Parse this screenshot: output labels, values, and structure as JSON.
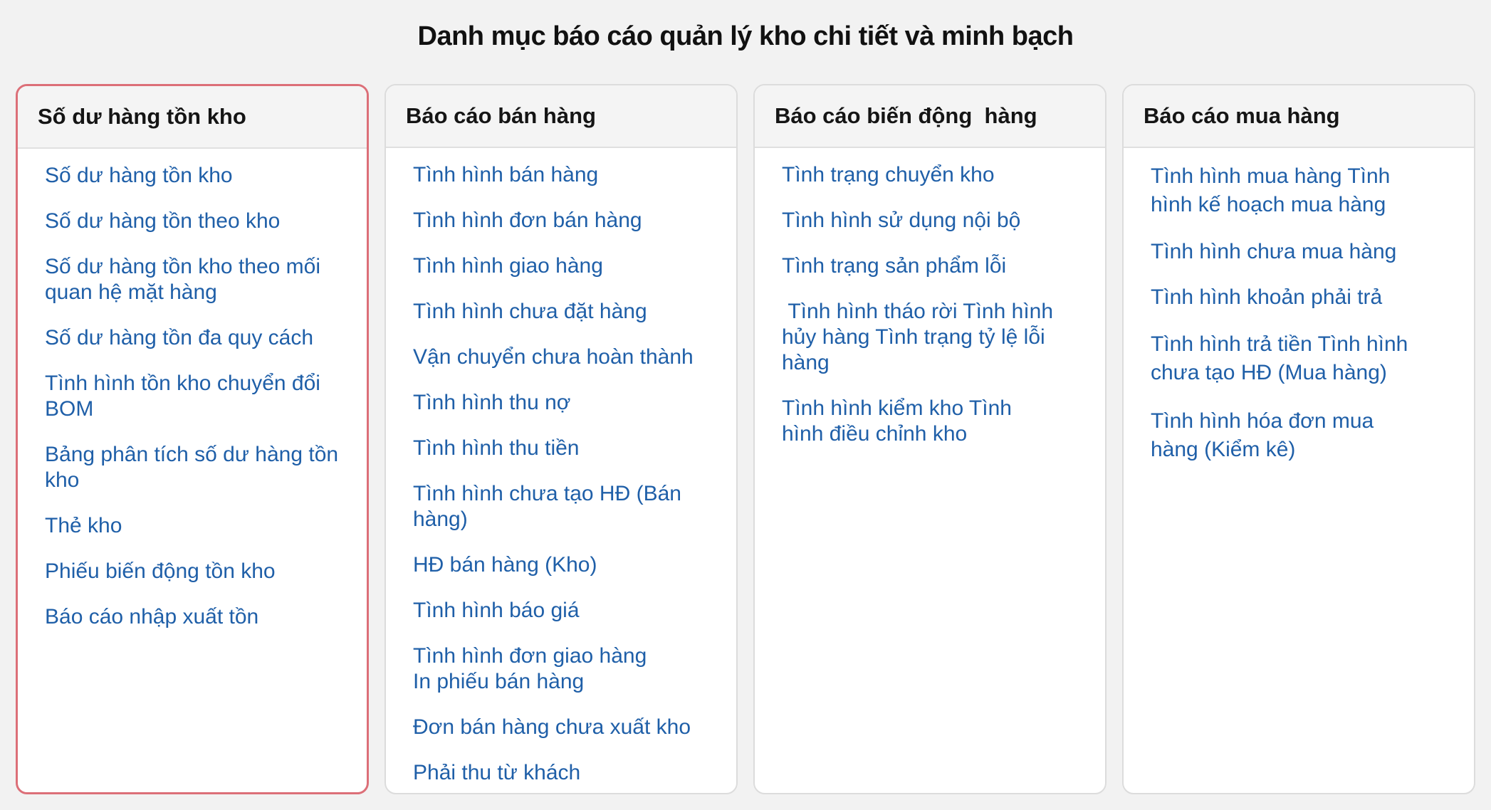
{
  "page": {
    "title": "Danh mục báo cáo quản lý kho chi tiết và minh bạch"
  },
  "colors": {
    "background": "#f2f2f2",
    "link": "#1f5fa8",
    "selected_border": "#dc6f78",
    "header_bg": "#f4f4f4"
  },
  "panels": [
    {
      "title": "Số dư hàng tồn kho",
      "selected": true,
      "items": [
        "Số dư hàng tồn kho",
        "Số dư hàng tồn theo kho",
        "Số dư hàng tồn kho theo mối quan hệ mặt hàng",
        "Số dư hàng tồn đa quy cách",
        "Tình hình tồn kho chuyển đổi BOM",
        "Bảng phân tích số dư hàng tồn kho",
        "Thẻ kho",
        "Phiếu biến động tồn kho",
        "Báo cáo nhập xuất tồn"
      ]
    },
    {
      "title": "Báo cáo bán hàng",
      "selected": false,
      "items": [
        "Tình hình bán hàng",
        "Tình hình đơn bán hàng",
        "Tình hình giao hàng",
        "Tình hình chưa đặt hàng",
        "Vận chuyển chưa hoàn thành",
        "Tình hình thu nợ",
        "Tình hình thu tiền",
        "Tình hình chưa tạo HĐ (Bán hàng)",
        "HĐ bán hàng (Kho)",
        "Tình hình báo giá",
        "Tình hình đơn giao hàng In phiếu bán hàng",
        "Đơn bán hàng chưa xuất kho",
        "Phải thu từ khách"
      ]
    },
    {
      "title": "Báo cáo biến động  hàng",
      "selected": false,
      "items": [
        "Tình trạng chuyển kho",
        "Tình hình sử dụng nội bộ",
        "Tình trạng sản phẩm lỗi",
        " Tình hình tháo rời Tình hình hủy hàng Tình trạng tỷ lệ lỗi hàng",
        "Tình hình kiểm kho Tình hình điều chỉnh kho"
      ]
    },
    {
      "title": "Báo cáo mua hàng",
      "selected": false,
      "items": [
        "Tình hình mua hàng Tình hình kế hoạch mua hàng",
        "Tình hình chưa mua hàng",
        "Tình hình khoản phải trả",
        "Tình hình trả tiền Tình hình chưa tạo HĐ (Mua hàng)",
        "Tình hình hóa đơn mua hàng (Kiểm kê)"
      ]
    }
  ]
}
